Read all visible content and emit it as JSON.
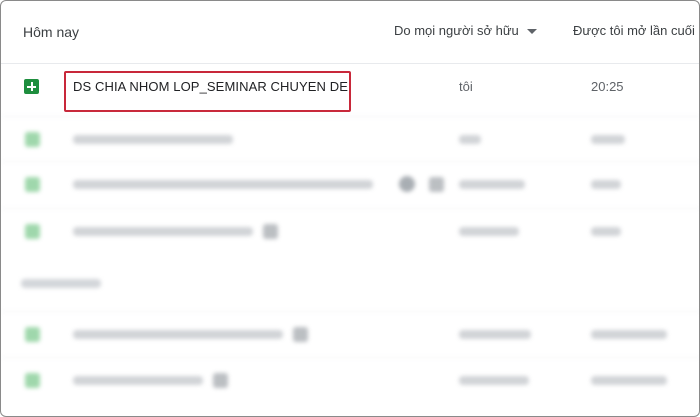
{
  "header": {
    "section_title": "Hôm nay",
    "owner_filter_label": "Do mọi người sở hữu",
    "last_opened_label": "Được tôi mở lần cuối"
  },
  "files": [
    {
      "icon": "google-sheets-icon",
      "name": "DS CHIA NHOM LOP_SEMINAR CHUYEN DE",
      "owner": "tôi",
      "last_opened": "20:25",
      "highlighted": true
    }
  ],
  "colors": {
    "sheets_green": "#1e8e3e",
    "highlight_red": "#c8283a"
  }
}
